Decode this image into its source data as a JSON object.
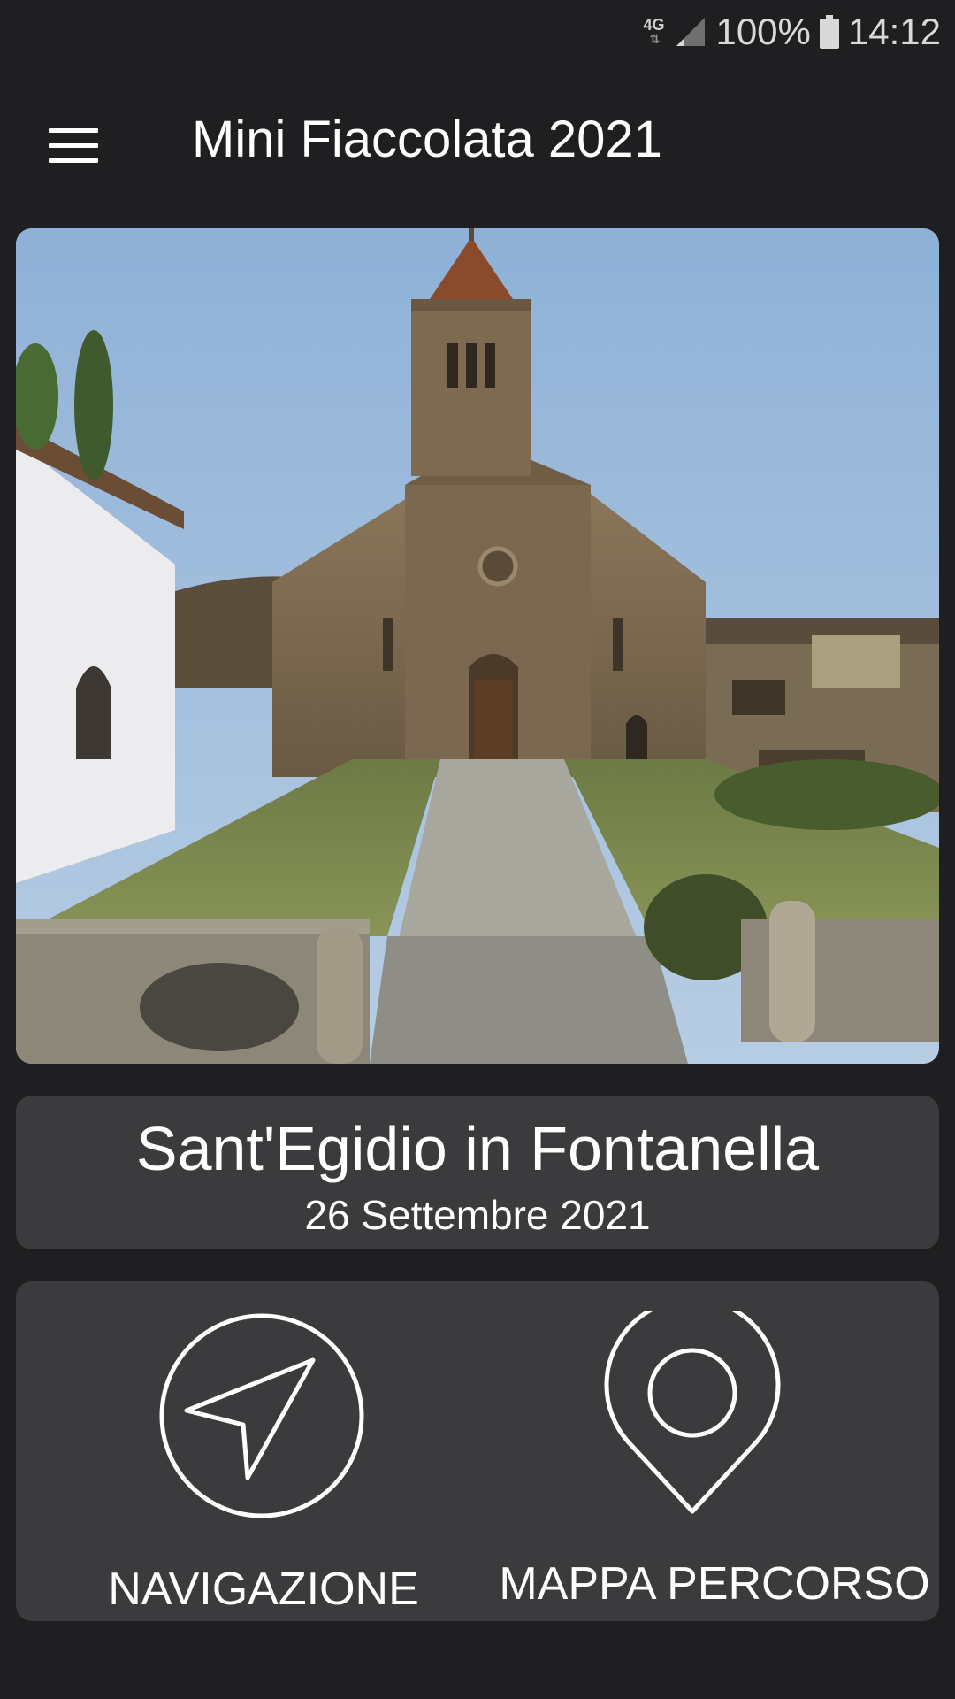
{
  "status_bar": {
    "network": "4G",
    "battery": "100%",
    "time": "14:12"
  },
  "toolbar": {
    "menu_icon": "hamburger-menu-icon",
    "title": "Mini Fiaccolata 2021"
  },
  "hero": {
    "image": "church-photo"
  },
  "event": {
    "place": "Sant'Egidio in Fontanella",
    "date": "26 Settembre 2021"
  },
  "actions": [
    {
      "label": "NAVIGAZIONE",
      "icon": "navigation-arrow-icon"
    },
    {
      "label": "MAPPA PERCORSO",
      "icon": "map-pin-icon"
    }
  ],
  "colors": {
    "background": "#1f1f21",
    "card": "#3b3b3d",
    "text": "#ffffff"
  }
}
